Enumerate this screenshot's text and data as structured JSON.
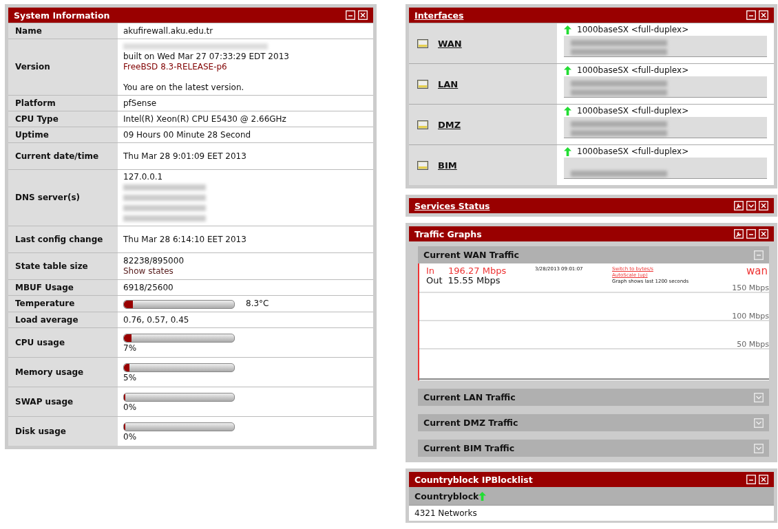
{
  "system_information": {
    "title": "System Information",
    "rows": [
      {
        "label": "Name",
        "kind": "text",
        "lines": [
          {
            "kind": "text",
            "text": "akufirewall.aku.edu.tr"
          }
        ]
      },
      {
        "label": "Version",
        "kind": "text",
        "lines": [
          {
            "kind": "blurred"
          },
          {
            "kind": "text",
            "text": "built on Wed Mar 27 07:33:29 EDT 2013"
          },
          {
            "kind": "accent",
            "text": "FreeBSD 8.3-RELEASE-p6"
          },
          {
            "kind": "blank"
          },
          {
            "kind": "text",
            "text": "You are on the latest version."
          }
        ]
      },
      {
        "label": "Platform",
        "kind": "text",
        "lines": [
          {
            "kind": "text",
            "text": "pfSense"
          }
        ]
      },
      {
        "label": "CPU Type",
        "kind": "text",
        "lines": [
          {
            "kind": "text",
            "text": "Intel(R) Xeon(R) CPU E5430 @ 2.66GHz"
          }
        ]
      },
      {
        "label": "Uptime",
        "kind": "text",
        "lines": [
          {
            "kind": "text",
            "text": "09 Hours 00 Minute 28 Second"
          }
        ]
      },
      {
        "label": "Current date/time",
        "kind": "text",
        "lines": [
          {
            "kind": "text",
            "text": "Thu Mar 28 9:01:09 EET 2013"
          }
        ]
      },
      {
        "label": "DNS server(s)",
        "kind": "text",
        "lines": [
          {
            "kind": "text",
            "text": "127.0.0.1"
          },
          {
            "kind": "blurred"
          },
          {
            "kind": "blurred"
          },
          {
            "kind": "blurred"
          },
          {
            "kind": "blurred"
          }
        ]
      },
      {
        "label": "Last config change",
        "kind": "text",
        "lines": [
          {
            "kind": "text",
            "text": "Thu Mar 28 6:14:10 EET 2013"
          }
        ]
      },
      {
        "label": "State table size",
        "kind": "text",
        "lines": [
          {
            "kind": "text",
            "text": "82238/895000"
          },
          {
            "kind": "link",
            "text": "Show states"
          }
        ]
      },
      {
        "label": "MBUF Usage",
        "kind": "text",
        "lines": [
          {
            "kind": "text",
            "text": "6918/25600"
          }
        ]
      },
      {
        "label": "Temperature",
        "kind": "meter_inline",
        "level": 0.08,
        "reading": "8.3°C"
      },
      {
        "label": "Load average",
        "kind": "text",
        "lines": [
          {
            "kind": "text",
            "text": "0.76, 0.57, 0.45"
          }
        ]
      },
      {
        "label": "CPU usage",
        "kind": "meter",
        "level": 0.07,
        "reading": "7%"
      },
      {
        "label": "Memory usage",
        "kind": "meter",
        "level": 0.05,
        "reading": "5%"
      },
      {
        "label": "SWAP usage",
        "kind": "meter",
        "level": 0,
        "reading": "0%"
      },
      {
        "label": "Disk usage",
        "kind": "meter",
        "level": 0,
        "reading": "0%"
      }
    ]
  },
  "interfaces": {
    "title": "Interfaces",
    "items": [
      {
        "name": "WAN",
        "up": true,
        "media": "1000baseSX <full-duplex>",
        "address_lines": [
          {
            "kind": "blurred"
          },
          {
            "kind": "blurred"
          }
        ]
      },
      {
        "name": "LAN",
        "up": true,
        "media": "1000baseSX <full-duplex>",
        "address_lines": [
          {
            "kind": "blurred"
          },
          {
            "kind": "blurred"
          }
        ]
      },
      {
        "name": "DMZ",
        "up": true,
        "media": "1000baseSX <full-duplex>",
        "address_lines": [
          {
            "kind": "blurred"
          },
          {
            "kind": "blurred"
          }
        ]
      },
      {
        "name": "BIM",
        "up": true,
        "media": "1000baseSX <full-duplex>",
        "address_lines": [
          {
            "kind": "blank"
          },
          {
            "kind": "blurred"
          }
        ]
      }
    ]
  },
  "services_status": {
    "title": "Services Status"
  },
  "traffic_graphs": {
    "title": "Traffic Graphs",
    "sections": [
      {
        "title": "Current WAN Traffic",
        "expanded": true,
        "graph": {
          "in_label": "In",
          "in_value": "196.27 Mbps",
          "out_label": "Out",
          "out_value": "15.55 Mbps",
          "timestamp": "3/28/2013 09:01:07",
          "switch_link": "Switch to bytes/s",
          "autoscale_link": "AutoScale (up)",
          "note": "Graph shows last 1200 seconds",
          "interface": "wan",
          "grid_labels": [
            "150 Mbps",
            "100 Mbps",
            "50 Mbps"
          ]
        }
      },
      {
        "title": "Current LAN Traffic",
        "expanded": false
      },
      {
        "title": "Current DMZ Traffic",
        "expanded": false
      },
      {
        "title": "Current BIM Traffic",
        "expanded": false
      }
    ]
  },
  "countryblock": {
    "title": "Countryblock IPBlocklist",
    "header": "Countryblock",
    "up": true,
    "value": "4321 Networks"
  }
}
